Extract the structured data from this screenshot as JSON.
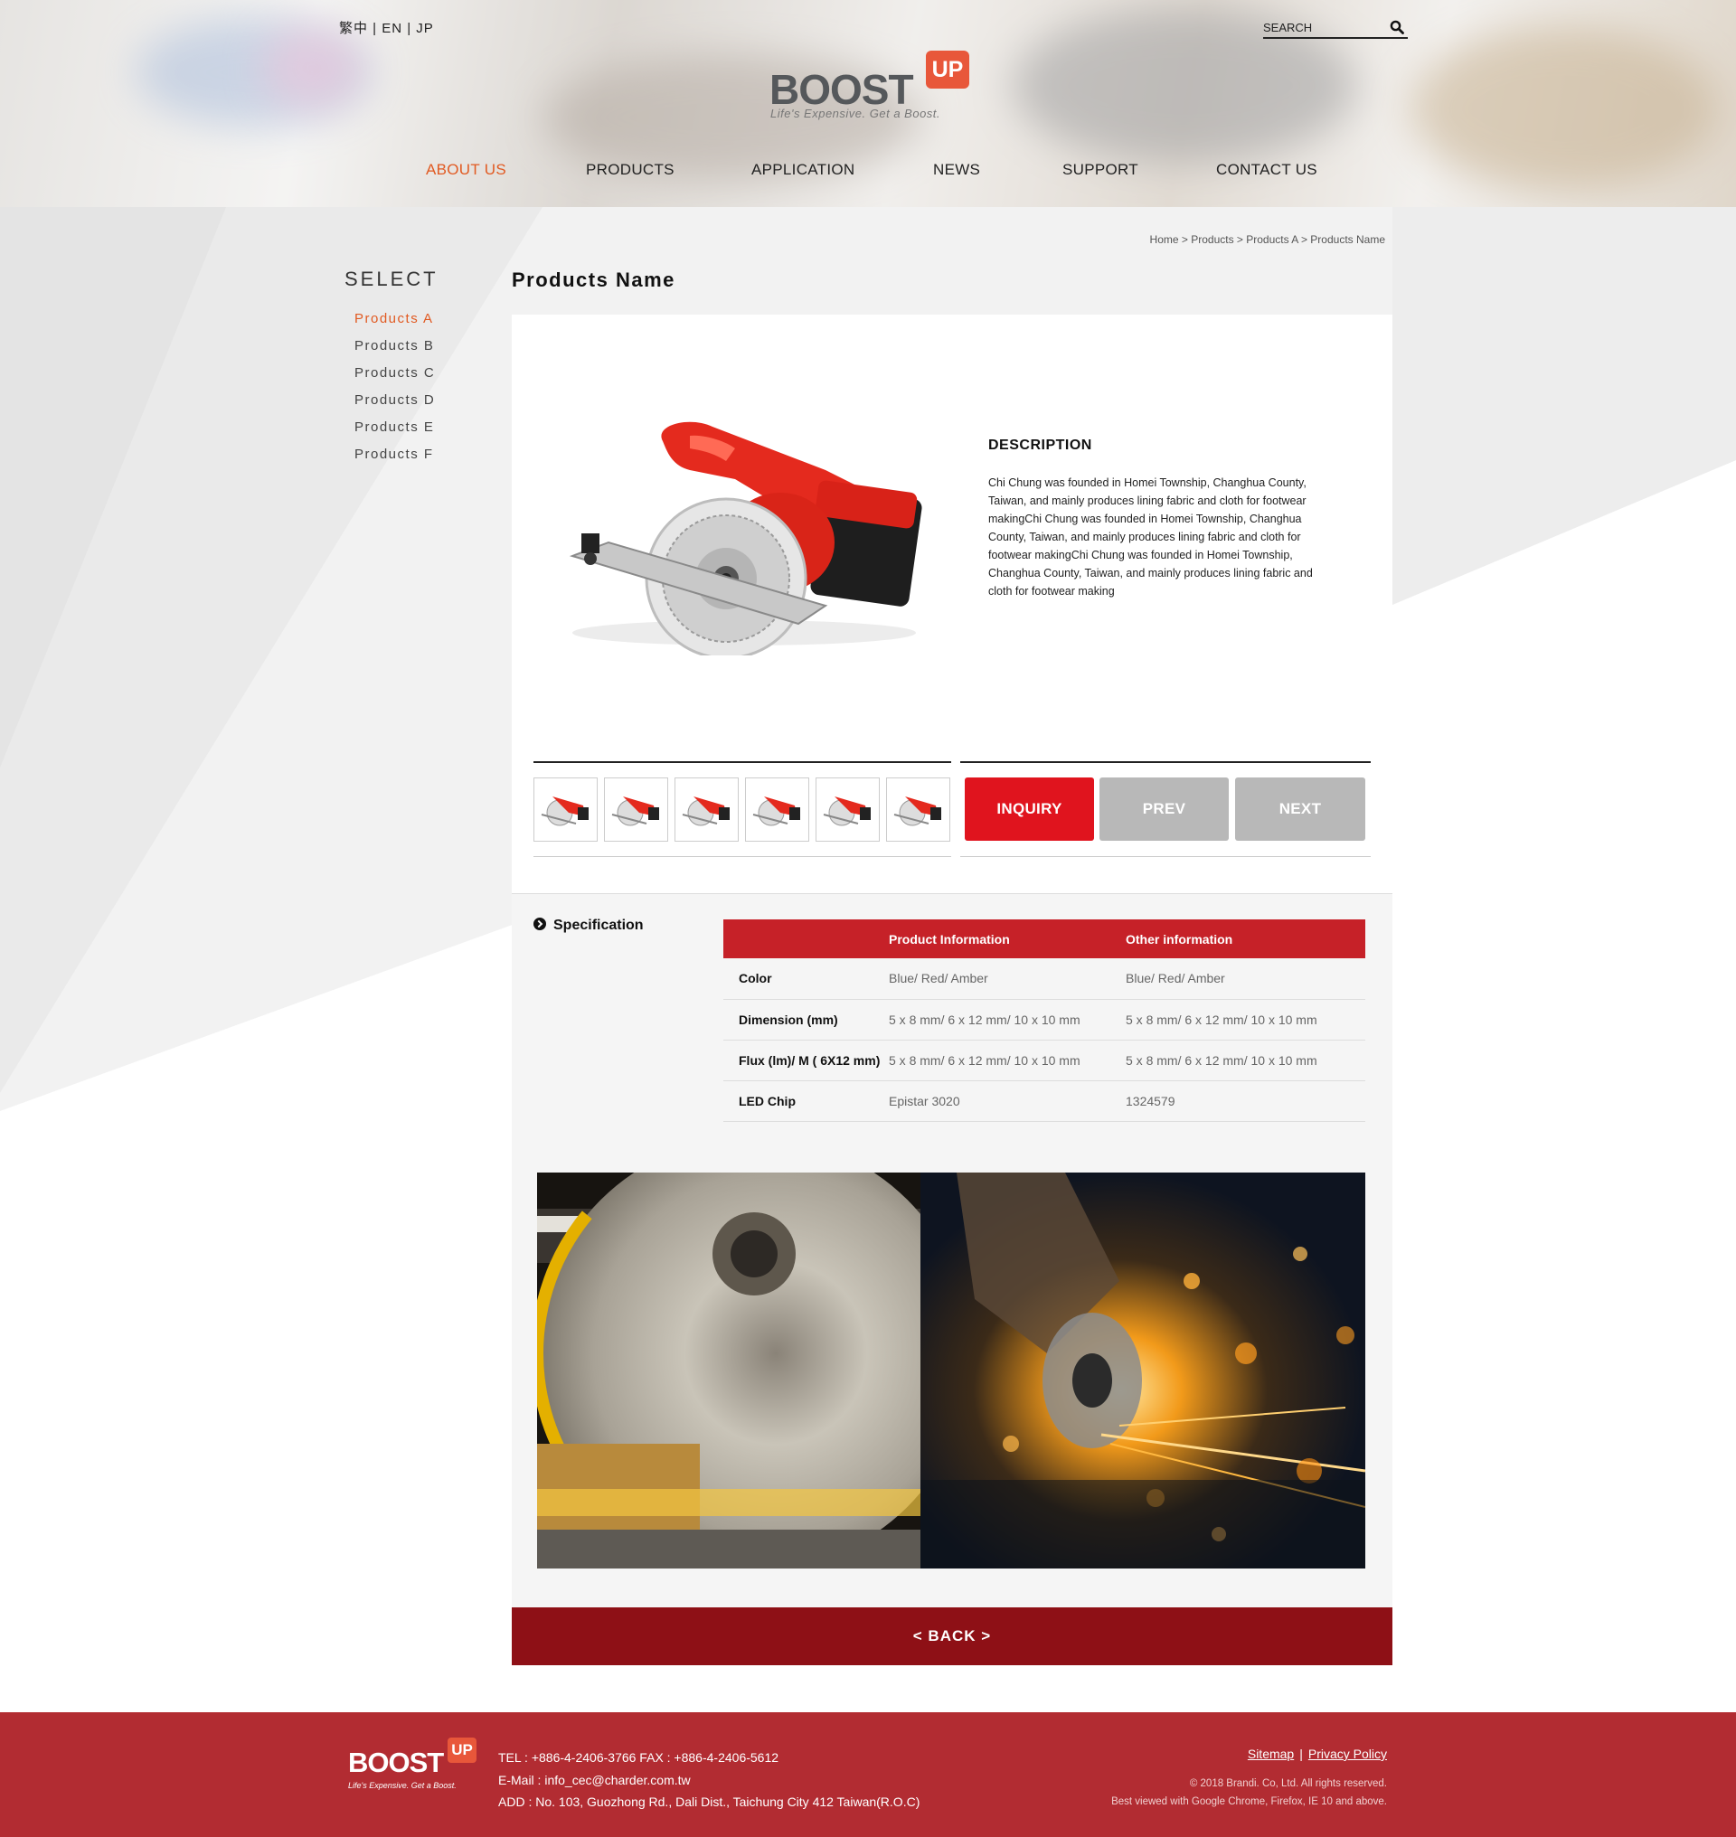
{
  "header": {
    "lang_switch": "繁中 | EN | JP",
    "search_placeholder": "SEARCH",
    "logo": {
      "word": "BOOST",
      "badge": "UP",
      "tagline": "Life's Expensive. Get a Boost."
    },
    "nav": [
      {
        "label": "ABOUT US",
        "active": true
      },
      {
        "label": "PRODUCTS",
        "active": false
      },
      {
        "label": "APPLICATION",
        "active": false
      },
      {
        "label": "NEWS",
        "active": false
      },
      {
        "label": "SUPPORT",
        "active": false
      },
      {
        "label": "CONTACT US",
        "active": false
      }
    ]
  },
  "sidebar": {
    "title": "SELECT",
    "items": [
      {
        "label": "Products A",
        "active": true
      },
      {
        "label": "Products B",
        "active": false
      },
      {
        "label": "Products C",
        "active": false
      },
      {
        "label": "Products D",
        "active": false
      },
      {
        "label": "Products E",
        "active": false
      },
      {
        "label": "Products F",
        "active": false
      }
    ]
  },
  "breadcrumb": "Home > Products > Products A > Products Name",
  "page_title": "Products Name",
  "product": {
    "description_title": "DESCRIPTION",
    "description": "Chi Chung was founded in Homei Township, Changhua County, Taiwan, and mainly produces lining fabric and cloth for footwear makingChi Chung was founded in Homei Township, Changhua County, Taiwan, and mainly produces lining fabric and cloth for footwear makingChi Chung was founded in Homei Township, Changhua County, Taiwan, and mainly produces lining fabric and cloth for footwear making",
    "thumbnail_count": 6,
    "buttons": {
      "inquiry": "INQUIRY",
      "prev": "PREV",
      "next": "NEXT"
    }
  },
  "spec": {
    "label": "Specification",
    "headers": [
      "",
      "Product Information",
      "Other information"
    ],
    "rows": [
      [
        "Color",
        "Blue/ Red/ Amber",
        "Blue/ Red/ Amber"
      ],
      [
        "Dimension (mm)",
        "5 x 8 mm/ 6 x 12 mm/ 10 x 10 mm",
        "5 x 8 mm/ 6 x 12 mm/ 10 x 10 mm"
      ],
      [
        "Flux (lm)/ M ( 6X12 mm)",
        "5 x 8 mm/ 6 x 12 mm/ 10 x 10 mm",
        "5 x 8 mm/ 6 x 12 mm/ 10 x 10 mm"
      ],
      [
        "LED Chip",
        "Epistar 3020",
        "1324579"
      ]
    ]
  },
  "back_label": "<  BACK  >",
  "footer": {
    "logo": {
      "word": "BOOST",
      "badge": "UP",
      "tagline": "Life's Expensive. Get a Boost."
    },
    "tel_fax": "TEL : +886-4-2406-3766   FAX : +886-4-2406-5612",
    "email": "E-Mail : info_cec@charder.com.tw",
    "address": "ADD : No. 103, Guozhong Rd., Dali Dist., Taichung City 412 Taiwan(R.O.C)",
    "sitemap": "Sitemap",
    "privacy": "Privacy Policy",
    "copyright": "© 2018 Brandi. Co, Ltd. All rights reserved.",
    "browser_note": "Best viewed with Google Chrome, Firefox, IE 10 and above."
  },
  "colors": {
    "accent_orange": "#e15a22",
    "inquiry_red": "#e0141e",
    "table_header_red": "#c62128",
    "back_bar": "#8e1016",
    "footer_bg": "#b22c32",
    "logo_badge": "#e8573a"
  },
  "icons": {
    "search": "search-icon",
    "spec_bullet": "chevron-circle-right-icon"
  }
}
